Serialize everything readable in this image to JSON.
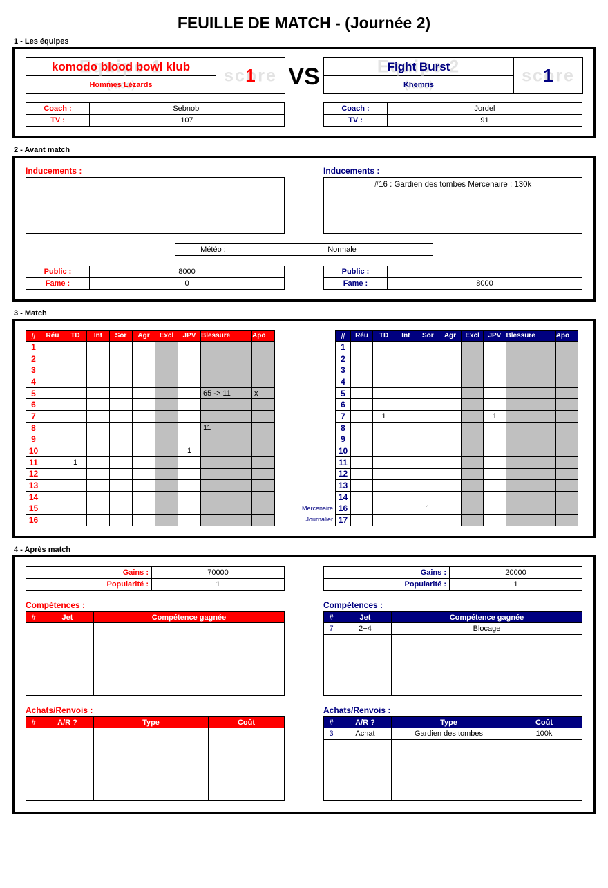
{
  "title": "FEUILLE DE MATCH - (Journée 2)",
  "sections": {
    "s1": "1 - Les équipes",
    "s2": "2 - Avant match",
    "s3": "3 - Match",
    "s4": "4 - Après match"
  },
  "vs": "VS",
  "watermarks": {
    "team1": "Equipe 1",
    "team2": "Equipe 2",
    "score": "score",
    "race": "(race)"
  },
  "colors": {
    "team1": "#ff0000",
    "team2": "#000080",
    "gray_cell": "#c0c0c0",
    "watermark": "#e3e3e3"
  },
  "team1": {
    "name": "komodo blood bowl klub",
    "race": "Hommes Lézards",
    "score": "1",
    "coach_label": "Coach :",
    "coach": "Sebnobi",
    "tv_label": "TV :",
    "tv": "107",
    "inducements_label": "Inducements :",
    "inducements": "",
    "public_label": "Public :",
    "public": "8000",
    "fame_label": "Fame :",
    "fame": "0",
    "gains_label": "Gains :",
    "gains": "70000",
    "popularite_label": "Popularité :",
    "popularite": "1",
    "competences_label": "Compétences :",
    "achats_label": "Achats/Renvois :"
  },
  "team2": {
    "name": "Fight Burst",
    "race": "Khemris",
    "score": "1",
    "coach_label": "Coach :",
    "coach": "Jordel",
    "tv_label": "TV :",
    "tv": "91",
    "inducements_label": "Inducements :",
    "inducements": "#16 : Gardien des tombes Mercenaire : 130k",
    "public_label": "Public :",
    "public": "",
    "fame_label": "Fame :",
    "fame": "8000",
    "gains_label": "Gains :",
    "gains": "20000",
    "popularite_label": "Popularité :",
    "popularite": "1",
    "competences_label": "Compétences :",
    "achats_label": "Achats/Renvois :"
  },
  "meteo": {
    "label": "Météo :",
    "value": "Normale"
  },
  "match_headers": [
    "#",
    "Réu",
    "TD",
    "Int",
    "Sor",
    "Agr",
    "Excl",
    "JPV",
    "Blessure",
    "Apo"
  ],
  "match_left": [
    {
      "num": "1",
      "reu": "",
      "td": "",
      "int": "",
      "sor": "",
      "agr": "",
      "excl": "",
      "jpv": "",
      "bl": "",
      "apo": "",
      "side": ""
    },
    {
      "num": "2",
      "reu": "",
      "td": "",
      "int": "",
      "sor": "",
      "agr": "",
      "excl": "",
      "jpv": "",
      "bl": "",
      "apo": "",
      "side": ""
    },
    {
      "num": "3",
      "reu": "",
      "td": "",
      "int": "",
      "sor": "",
      "agr": "",
      "excl": "",
      "jpv": "",
      "bl": "",
      "apo": "",
      "side": ""
    },
    {
      "num": "4",
      "reu": "",
      "td": "",
      "int": "",
      "sor": "",
      "agr": "",
      "excl": "",
      "jpv": "",
      "bl": "",
      "apo": "",
      "side": ""
    },
    {
      "num": "5",
      "reu": "",
      "td": "",
      "int": "",
      "sor": "",
      "agr": "",
      "excl": "",
      "jpv": "",
      "bl": "65 -> 11",
      "apo": "x",
      "side": ""
    },
    {
      "num": "6",
      "reu": "",
      "td": "",
      "int": "",
      "sor": "",
      "agr": "",
      "excl": "",
      "jpv": "",
      "bl": "",
      "apo": "",
      "side": ""
    },
    {
      "num": "7",
      "reu": "",
      "td": "",
      "int": "",
      "sor": "",
      "agr": "",
      "excl": "",
      "jpv": "",
      "bl": "",
      "apo": "",
      "side": ""
    },
    {
      "num": "8",
      "reu": "",
      "td": "",
      "int": "",
      "sor": "",
      "agr": "",
      "excl": "",
      "jpv": "",
      "bl": "11",
      "apo": "",
      "side": ""
    },
    {
      "num": "9",
      "reu": "",
      "td": "",
      "int": "",
      "sor": "",
      "agr": "",
      "excl": "",
      "jpv": "",
      "bl": "",
      "apo": "",
      "side": ""
    },
    {
      "num": "10",
      "reu": "",
      "td": "",
      "int": "",
      "sor": "",
      "agr": "",
      "excl": "",
      "jpv": "1",
      "bl": "",
      "apo": "",
      "side": ""
    },
    {
      "num": "11",
      "reu": "",
      "td": "1",
      "int": "",
      "sor": "",
      "agr": "",
      "excl": "",
      "jpv": "",
      "bl": "",
      "apo": "",
      "side": ""
    },
    {
      "num": "12",
      "reu": "",
      "td": "",
      "int": "",
      "sor": "",
      "agr": "",
      "excl": "",
      "jpv": "",
      "bl": "",
      "apo": "",
      "side": ""
    },
    {
      "num": "13",
      "reu": "",
      "td": "",
      "int": "",
      "sor": "",
      "agr": "",
      "excl": "",
      "jpv": "",
      "bl": "",
      "apo": "",
      "side": ""
    },
    {
      "num": "14",
      "reu": "",
      "td": "",
      "int": "",
      "sor": "",
      "agr": "",
      "excl": "",
      "jpv": "",
      "bl": "",
      "apo": "",
      "side": ""
    },
    {
      "num": "15",
      "reu": "",
      "td": "",
      "int": "",
      "sor": "",
      "agr": "",
      "excl": "",
      "jpv": "",
      "bl": "",
      "apo": "",
      "side": ""
    },
    {
      "num": "16",
      "reu": "",
      "td": "",
      "int": "",
      "sor": "",
      "agr": "",
      "excl": "",
      "jpv": "",
      "bl": "",
      "apo": "",
      "side": ""
    }
  ],
  "match_right": [
    {
      "num": "1",
      "reu": "",
      "td": "",
      "int": "",
      "sor": "",
      "agr": "",
      "excl": "",
      "jpv": "",
      "bl": "",
      "apo": "",
      "side": ""
    },
    {
      "num": "2",
      "reu": "",
      "td": "",
      "int": "",
      "sor": "",
      "agr": "",
      "excl": "",
      "jpv": "",
      "bl": "",
      "apo": "",
      "side": ""
    },
    {
      "num": "3",
      "reu": "",
      "td": "",
      "int": "",
      "sor": "",
      "agr": "",
      "excl": "",
      "jpv": "",
      "bl": "",
      "apo": "",
      "side": ""
    },
    {
      "num": "4",
      "reu": "",
      "td": "",
      "int": "",
      "sor": "",
      "agr": "",
      "excl": "",
      "jpv": "",
      "bl": "",
      "apo": "",
      "side": ""
    },
    {
      "num": "5",
      "reu": "",
      "td": "",
      "int": "",
      "sor": "",
      "agr": "",
      "excl": "",
      "jpv": "",
      "bl": "",
      "apo": "",
      "side": ""
    },
    {
      "num": "6",
      "reu": "",
      "td": "",
      "int": "",
      "sor": "",
      "agr": "",
      "excl": "",
      "jpv": "",
      "bl": "",
      "apo": "",
      "side": ""
    },
    {
      "num": "7",
      "reu": "",
      "td": "1",
      "int": "",
      "sor": "",
      "agr": "",
      "excl": "",
      "jpv": "1",
      "bl": "",
      "apo": "",
      "side": ""
    },
    {
      "num": "8",
      "reu": "",
      "td": "",
      "int": "",
      "sor": "",
      "agr": "",
      "excl": "",
      "jpv": "",
      "bl": "",
      "apo": "",
      "side": ""
    },
    {
      "num": "9",
      "reu": "",
      "td": "",
      "int": "",
      "sor": "",
      "agr": "",
      "excl": "",
      "jpv": "",
      "bl": "",
      "apo": "",
      "side": ""
    },
    {
      "num": "10",
      "reu": "",
      "td": "",
      "int": "",
      "sor": "",
      "agr": "",
      "excl": "",
      "jpv": "",
      "bl": "",
      "apo": "",
      "side": ""
    },
    {
      "num": "11",
      "reu": "",
      "td": "",
      "int": "",
      "sor": "",
      "agr": "",
      "excl": "",
      "jpv": "",
      "bl": "",
      "apo": "",
      "side": ""
    },
    {
      "num": "12",
      "reu": "",
      "td": "",
      "int": "",
      "sor": "",
      "agr": "",
      "excl": "",
      "jpv": "",
      "bl": "",
      "apo": "",
      "side": ""
    },
    {
      "num": "13",
      "reu": "",
      "td": "",
      "int": "",
      "sor": "",
      "agr": "",
      "excl": "",
      "jpv": "",
      "bl": "",
      "apo": "",
      "side": ""
    },
    {
      "num": "14",
      "reu": "",
      "td": "",
      "int": "",
      "sor": "",
      "agr": "",
      "excl": "",
      "jpv": "",
      "bl": "",
      "apo": "",
      "side": ""
    },
    {
      "num": "16",
      "reu": "",
      "td": "",
      "int": "",
      "sor": "1",
      "agr": "",
      "excl": "",
      "jpv": "",
      "bl": "",
      "apo": "",
      "side": "Mercenaire"
    },
    {
      "num": "17",
      "reu": "",
      "td": "",
      "int": "",
      "sor": "",
      "agr": "",
      "excl": "",
      "jpv": "",
      "bl": "",
      "apo": "",
      "side": "Journalier"
    }
  ],
  "competences_headers": [
    "#",
    "Jet",
    "Compétence gagnée"
  ],
  "competences_left": [],
  "competences_right": [
    {
      "num": "7",
      "jet": "2+4",
      "comp": "Blocage"
    }
  ],
  "achats_headers": [
    "#",
    "A/R ?",
    "Type",
    "Coût"
  ],
  "achats_left": [],
  "achats_right": [
    {
      "num": "3",
      "ar": "Achat",
      "type": "Gardien des tombes",
      "cout": "100k"
    }
  ]
}
